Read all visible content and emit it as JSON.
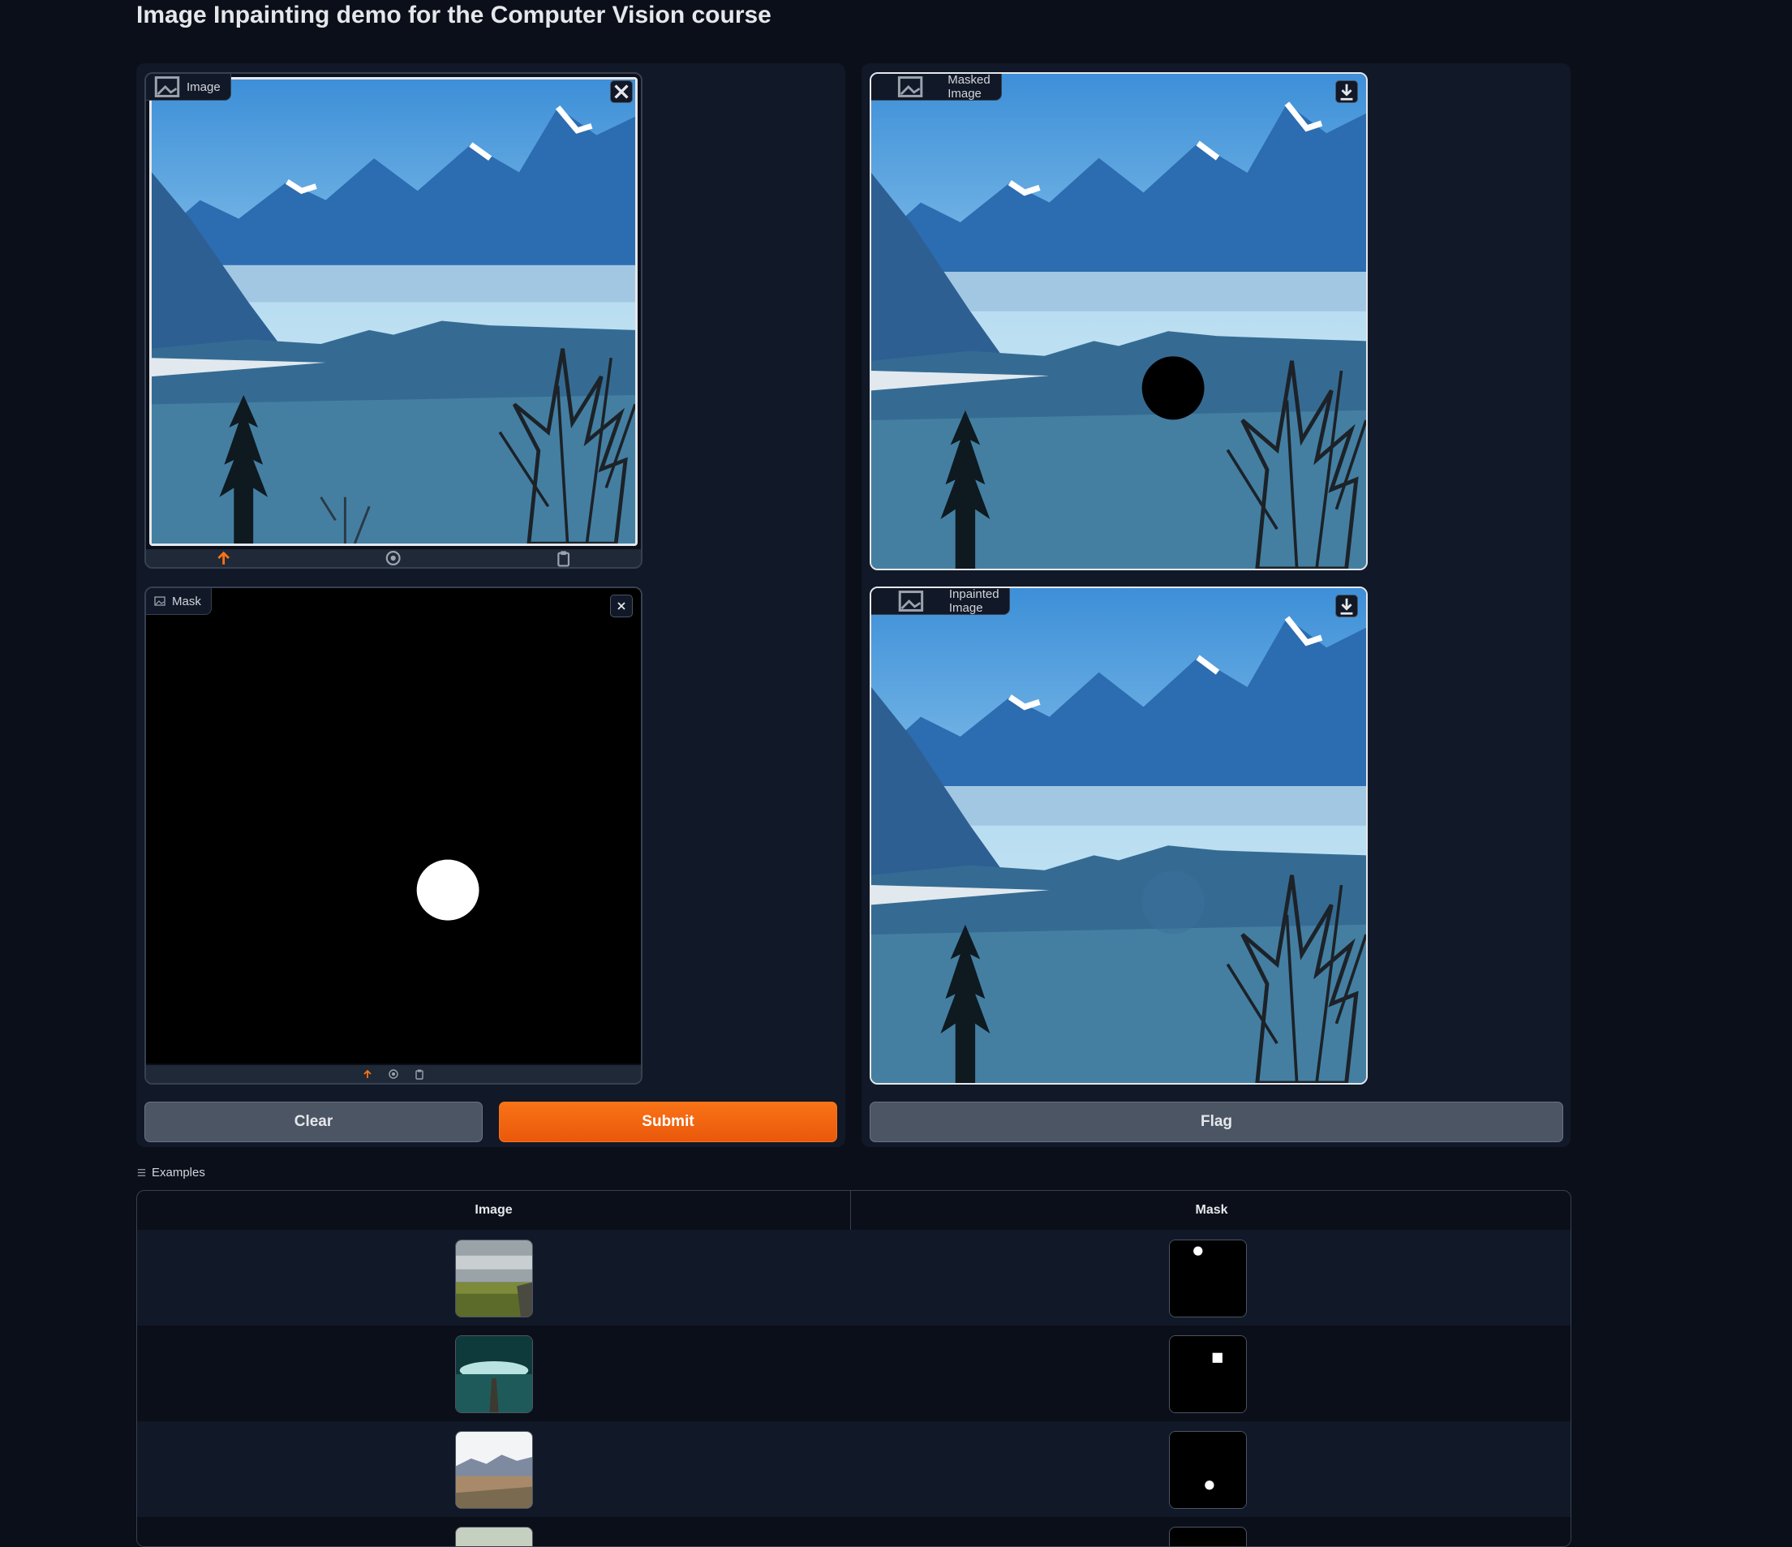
{
  "page": {
    "title": "Image Inpainting demo for the Computer Vision course"
  },
  "inputs": {
    "image_label": "Image",
    "mask_label": "Mask",
    "clear_label": "Clear",
    "submit_label": "Submit"
  },
  "outputs": {
    "masked_label": "Masked Image",
    "inpainted_label": "Inpainted Image",
    "flag_label": "Flag"
  },
  "examples": {
    "section_label": "Examples",
    "columns": [
      "Image",
      "Mask"
    ],
    "rows": [
      {
        "image": "grassland-thumbnail",
        "mask": "dot-top-mask"
      },
      {
        "image": "pier-lake-thumbnail",
        "mask": "square-mask"
      },
      {
        "image": "desert-mountains-thumbnail",
        "mask": "dot-bottom-mask"
      }
    ]
  },
  "colors": {
    "background": "#0b0f19",
    "panel": "#111827",
    "accent": "#f97316",
    "button_gray": "#4b5563"
  }
}
